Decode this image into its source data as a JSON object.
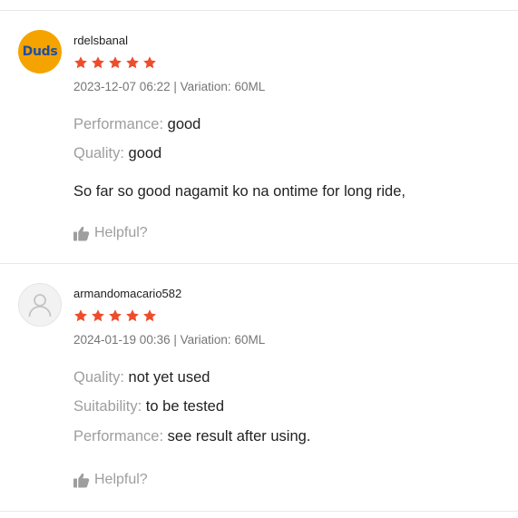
{
  "reviews": [
    {
      "username": "rdelsbanal",
      "avatar_text": "Duds",
      "rating": 5,
      "date": "2023-12-07 06:22",
      "separator": "|",
      "variation_label": "Variation:",
      "variation_value": "60ML",
      "attributes": [
        {
          "key": "Performance:",
          "value": "good"
        },
        {
          "key": "Quality:",
          "value": "good"
        }
      ],
      "comment": "So far so good nagamit ko na ontime for long ride,",
      "helpful_label": "Helpful?"
    },
    {
      "username": "armandomacario582",
      "rating": 5,
      "date": "2024-01-19 00:36",
      "separator": "|",
      "variation_label": "Variation:",
      "variation_value": "60ML",
      "attributes": [
        {
          "key": "Quality:",
          "value": "not yet used"
        },
        {
          "key": "Suitability:",
          "value": "to be tested"
        },
        {
          "key": "Performance:",
          "value": "see result after using."
        }
      ],
      "helpful_label": "Helpful?"
    }
  ],
  "colors": {
    "star": "#ee4d2d",
    "label_grey": "#9e9e9e",
    "text": "#212121",
    "avatar_bg": "#f5a300",
    "avatar_text": "#1d4fa3"
  },
  "icons": {
    "star": "star-icon",
    "helpful": "thumbs-up-icon",
    "default_avatar": "user-icon"
  }
}
